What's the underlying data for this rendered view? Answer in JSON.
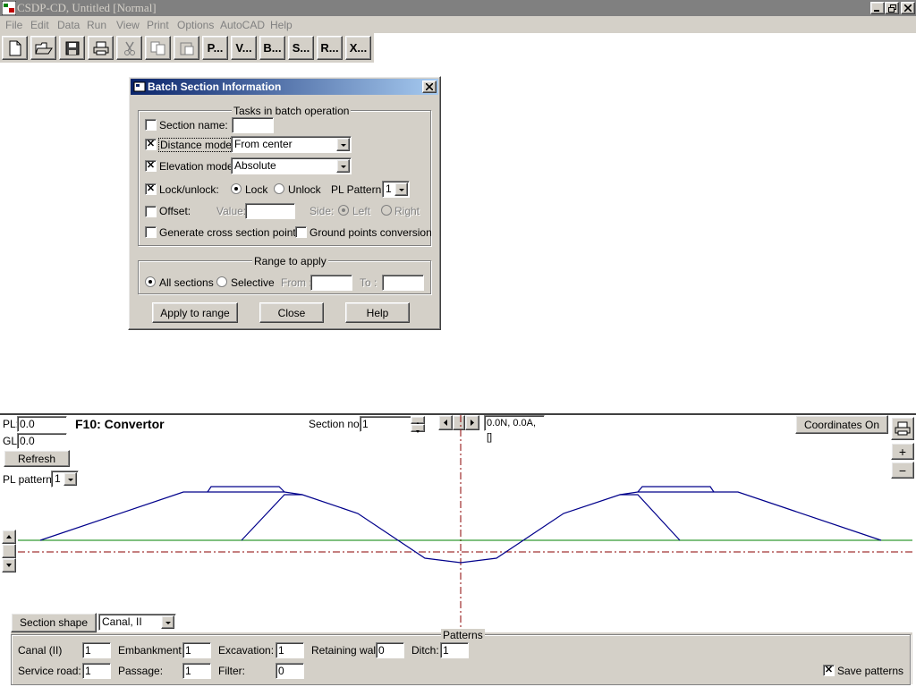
{
  "window": {
    "title": "CSDP-CD, Untitled [Normal]"
  },
  "menu": {
    "items": [
      "File",
      "Edit",
      "Data",
      "Run",
      "View",
      "Print",
      "Options",
      "AutoCAD",
      "Help"
    ]
  },
  "toolbar": {
    "text_buttons": [
      "P...",
      "V...",
      "B...",
      "S...",
      "R...",
      "X..."
    ]
  },
  "dialog": {
    "title": "Batch Section Information",
    "tasks_group": "Tasks in batch operation",
    "section_name_label": "Section name:",
    "section_name_value": "",
    "distance_mode_label": "Distance mode:",
    "distance_mode_value": "From center",
    "elevation_mode_label": "Elevation mode:",
    "elevation_mode_value": "Absolute",
    "lock_unlock_label": "Lock/unlock:",
    "lock_label": "Lock",
    "unlock_label": "Unlock",
    "pl_pattern_label": "PL Pattern:",
    "pl_pattern_value": "1",
    "offset_label": "Offset:",
    "value_label": "Value:",
    "side_label": "Side:",
    "left_label": "Left",
    "right_label": "Right",
    "gen_cross_label": "Generate cross section points",
    "ground_conv_label": "Ground points conversion",
    "range_group": "Range to apply",
    "all_sections_label": "All sections",
    "selective_label": "Selective",
    "from_label": "From :",
    "to_label": "To :",
    "apply_button": "Apply to range",
    "close_button": "Close",
    "help_button": "Help",
    "checks": {
      "section_name": false,
      "distance_mode": true,
      "elevation_mode": true,
      "lock_unlock": true,
      "offset": false,
      "gen_cross": false,
      "ground_conv": false
    }
  },
  "panel": {
    "pl_label": "PL:",
    "pl_value": "0.0",
    "gl_label": "GL:",
    "gl_value": "0.0",
    "title": "F10: Convertor",
    "section_no_label": "Section no.:",
    "section_no_value": "1",
    "coord_readout": "0.0N, 0.0A, []",
    "coordinates_button": "Coordinates On",
    "refresh_button": "Refresh",
    "pl_pattern_label": "PL pattern:",
    "pl_pattern_value": "1",
    "zoom_in": "+",
    "zoom_out": "−",
    "section_shape_button": "Section shape",
    "section_shape_value": "Canal, II",
    "patterns_group": "Patterns",
    "canal_label": "Canal (II)",
    "canal_value": "1",
    "embankment_label": "Embankment:",
    "embankment_value": "1",
    "excavation_label": "Excavation:",
    "excavation_value": "1",
    "retaining_label": "Retaining wall:",
    "retaining_value": "0",
    "ditch_label": "Ditch:",
    "ditch_value": "1",
    "service_road_label": "Service road:",
    "service_road_value": "1",
    "passage_label": "Passage:",
    "passage_value": "1",
    "filter_label": "Filter:",
    "filter_value": "0",
    "save_patterns_label": "Save patterns",
    "save_patterns_checked": true
  },
  "colors": {
    "title_bar_inactive": "#808080",
    "dialog_title_active": "#0a246a",
    "profile_line": "#00008b",
    "ground_line": "#008000",
    "center_line": "#8b0000"
  }
}
